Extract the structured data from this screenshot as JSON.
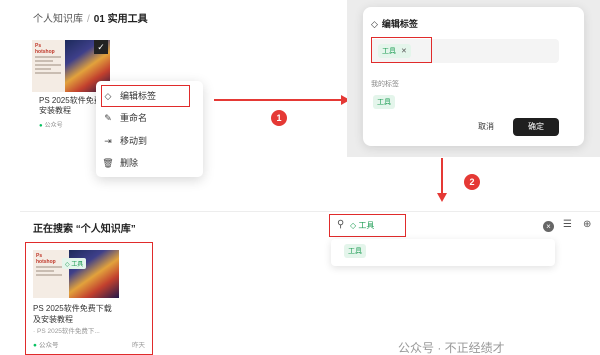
{
  "breadcrumb": {
    "root": "个人知识库",
    "separator": "/",
    "current": "01 实用工具"
  },
  "card": {
    "thumb_brand": "Ps\nhotshop",
    "title": "PS 2025软件免费下载及安装教程",
    "title_short": "PS 2025软件免费下载\n及安装教程",
    "source": "公众号",
    "snippet": "PS 2025软件免费下...",
    "date": "昨天",
    "tag": "工具"
  },
  "context_menu": {
    "items": [
      {
        "icon": "tag-icon",
        "label": "编辑标签"
      },
      {
        "icon": "rename-icon",
        "label": "重命名"
      },
      {
        "icon": "move-icon",
        "label": "移动到"
      },
      {
        "icon": "trash-icon",
        "label": "删除"
      }
    ]
  },
  "steps": {
    "one": "1",
    "two": "2"
  },
  "dialog": {
    "title": "编辑标签",
    "input_tag": "工具",
    "my_tags_label": "我的标签",
    "my_tags": [
      "工具"
    ],
    "cancel_label": "取消",
    "confirm_label": "确定"
  },
  "search": {
    "title": "正在搜索 “个人知识库”",
    "tag": "工具",
    "dropdown_tags": [
      "工具"
    ]
  },
  "watermark": "公众号 · 不正经绩才",
  "colors": {
    "highlight": "#e02b2b",
    "tag_green": "#1f9d55",
    "tag_bg": "#e4f5eb",
    "primary_btn": "#1f1f1f"
  }
}
